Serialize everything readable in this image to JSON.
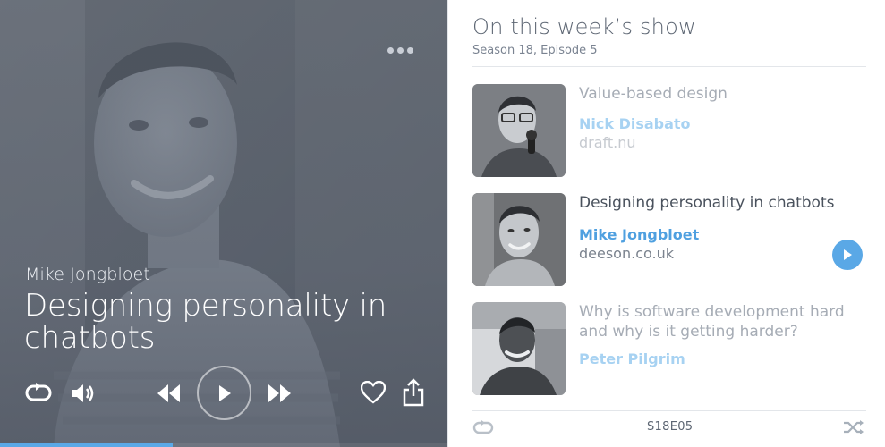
{
  "player": {
    "speaker": "Mike Jongbloet",
    "title": "Designing personality in chatbots",
    "progress": 0.385,
    "controls": {
      "repeat_icon": "repeat-icon",
      "volume_icon": "volume-icon",
      "rewind_icon": "rewind-icon",
      "play_icon": "play-icon",
      "forward_icon": "fast-forward-icon",
      "like_icon": "heart-icon",
      "share_icon": "share-icon",
      "more_icon": "more-dots-icon"
    }
  },
  "panel": {
    "title": "On this week’s show",
    "subtitle": "Season 18, Episode 5",
    "episodes": [
      {
        "title": "Value-based design",
        "speaker": "Nick Disabato",
        "site": "draft.nu",
        "state": "dim"
      },
      {
        "title": "Designing personality in chatbots",
        "speaker": "Mike Jongbloet",
        "site": "deeson.co.uk",
        "state": "active"
      },
      {
        "title": "Why is software development hard and why is it getting harder?",
        "speaker": "Peter Pilgrim",
        "site": "",
        "state": "dim"
      }
    ],
    "footer": {
      "code": "S18E05",
      "left_icon": "repeat-icon",
      "right_icon": "shuffle-icon"
    }
  },
  "colors": {
    "accent": "#5aa8e6",
    "title_text": "#5d6673",
    "player_tint": "#5c6675"
  }
}
